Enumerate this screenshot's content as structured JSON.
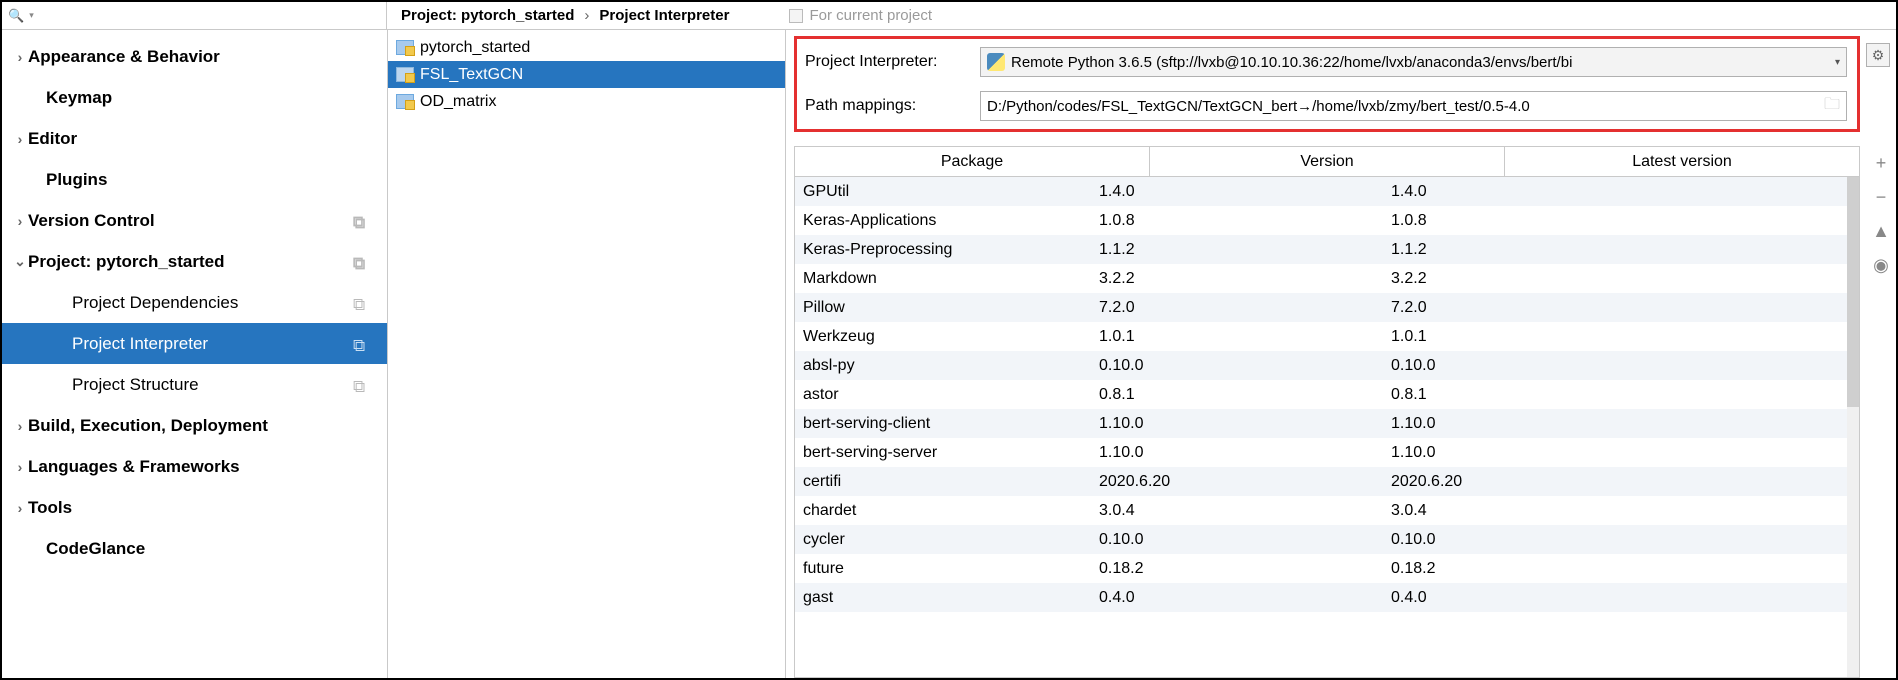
{
  "search": {
    "placeholder": ""
  },
  "breadcrumb": {
    "project_label": "Project:",
    "project_name": "pytorch_started",
    "section": "Project Interpreter",
    "current_project": "For current project"
  },
  "sidebar": {
    "items": [
      {
        "label": "Appearance & Behavior",
        "bold": true,
        "chev": true,
        "indent": 0
      },
      {
        "label": "Keymap",
        "bold": true,
        "indent": 1
      },
      {
        "label": "Editor",
        "bold": true,
        "chev": true,
        "indent": 0
      },
      {
        "label": "Plugins",
        "bold": true,
        "indent": 1
      },
      {
        "label": "Version Control",
        "bold": true,
        "chev": true,
        "indent": 0,
        "copy": true
      },
      {
        "label": "Project: pytorch_started",
        "bold": true,
        "chev_open": true,
        "indent": 0,
        "copy": true
      },
      {
        "label": "Project Dependencies",
        "indent": 2,
        "copy": true
      },
      {
        "label": "Project Interpreter",
        "indent": 2,
        "copy": true,
        "selected": true
      },
      {
        "label": "Project Structure",
        "indent": 2,
        "copy": true
      },
      {
        "label": "Build, Execution, Deployment",
        "bold": true,
        "chev": true,
        "indent": 0
      },
      {
        "label": "Languages & Frameworks",
        "bold": true,
        "chev": true,
        "indent": 0
      },
      {
        "label": "Tools",
        "bold": true,
        "chev": true,
        "indent": 0
      },
      {
        "label": "CodeGlance",
        "bold": true,
        "indent": 1
      }
    ]
  },
  "projects": [
    {
      "name": "pytorch_started"
    },
    {
      "name": "FSL_TextGCN",
      "selected": true
    },
    {
      "name": "OD_matrix"
    }
  ],
  "interpreter": {
    "label": "Project Interpreter:",
    "value": "Remote Python 3.6.5 (sftp://lvxb@10.10.10.36:22/home/lvxb/anaconda3/envs/bert/bi",
    "path_label": "Path mappings:",
    "path_value": "D:/Python/codes/FSL_TextGCN/TextGCN_bert→/home/lvxb/zmy/bert_test/0.5-4.0"
  },
  "table": {
    "columns": [
      "Package",
      "Version",
      "Latest version"
    ],
    "rows": [
      [
        "GPUtil",
        "1.4.0",
        "1.4.0"
      ],
      [
        "Keras-Applications",
        "1.0.8",
        "1.0.8"
      ],
      [
        "Keras-Preprocessing",
        "1.1.2",
        "1.1.2"
      ],
      [
        "Markdown",
        "3.2.2",
        "3.2.2"
      ],
      [
        "Pillow",
        "7.2.0",
        "7.2.0"
      ],
      [
        "Werkzeug",
        "1.0.1",
        "1.0.1"
      ],
      [
        "absl-py",
        "0.10.0",
        "0.10.0"
      ],
      [
        "astor",
        "0.8.1",
        "0.8.1"
      ],
      [
        "bert-serving-client",
        "1.10.0",
        "1.10.0"
      ],
      [
        "bert-serving-server",
        "1.10.0",
        "1.10.0"
      ],
      [
        "certifi",
        "2020.6.20",
        "2020.6.20"
      ],
      [
        "chardet",
        "3.0.4",
        "3.0.4"
      ],
      [
        "cycler",
        "0.10.0",
        "0.10.0"
      ],
      [
        "future",
        "0.18.2",
        "0.18.2"
      ],
      [
        "gast",
        "0.4.0",
        "0.4.0"
      ]
    ]
  },
  "tools": {
    "add": "+",
    "remove": "−",
    "up": "▲",
    "eye": "◉"
  }
}
